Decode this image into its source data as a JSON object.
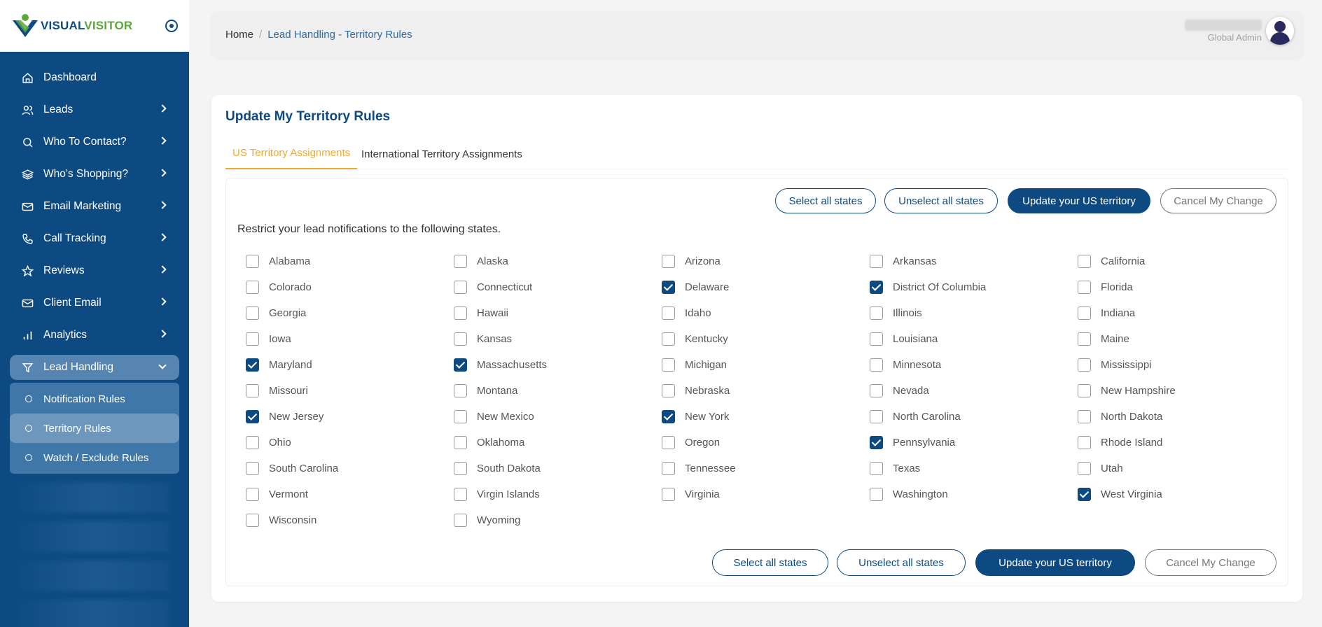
{
  "brand": {
    "part1": "VISUAL",
    "part2": "VISITOR"
  },
  "sidebar": {
    "items": [
      {
        "label": "Dashboard",
        "icon": "home-icon"
      },
      {
        "label": "Leads",
        "icon": "users-icon"
      },
      {
        "label": "Who To Contact?",
        "icon": "search-icon"
      },
      {
        "label": "Who's Shopping?",
        "icon": "layers-icon"
      },
      {
        "label": "Email Marketing",
        "icon": "mail-icon"
      },
      {
        "label": "Call Tracking",
        "icon": "phone-icon"
      },
      {
        "label": "Reviews",
        "icon": "star-icon"
      },
      {
        "label": "Client Email",
        "icon": "mail-icon"
      },
      {
        "label": "Analytics",
        "icon": "bar-chart-icon"
      },
      {
        "label": "Lead Handling",
        "icon": "filter-icon"
      }
    ],
    "subitems": [
      {
        "label": "Notification Rules"
      },
      {
        "label": "Territory Rules"
      },
      {
        "label": "Watch / Exclude Rules"
      }
    ]
  },
  "header": {
    "home": "Home",
    "sep": "/",
    "current": "Lead Handling - Territory Rules",
    "user_role": "Global Admin"
  },
  "card": {
    "title": "Update My Territory Rules",
    "tabs": [
      "US Territory Assignments",
      "International Territory Assignments"
    ],
    "buttons": {
      "select_all": "Select all states",
      "unselect_all": "Unselect all states",
      "update": "Update your US territory",
      "cancel": "Cancel My Change"
    },
    "restrict_text": "Restrict your lead notifications to the following states.",
    "states": [
      [
        "Alabama",
        false
      ],
      [
        "Alaska",
        false
      ],
      [
        "Arizona",
        false
      ],
      [
        "Arkansas",
        false
      ],
      [
        "California",
        false
      ],
      [
        "Colorado",
        false
      ],
      [
        "Connecticut",
        false
      ],
      [
        "Delaware",
        true
      ],
      [
        "District Of Columbia",
        true
      ],
      [
        "Florida",
        false
      ],
      [
        "Georgia",
        false
      ],
      [
        "Hawaii",
        false
      ],
      [
        "Idaho",
        false
      ],
      [
        "Illinois",
        false
      ],
      [
        "Indiana",
        false
      ],
      [
        "Iowa",
        false
      ],
      [
        "Kansas",
        false
      ],
      [
        "Kentucky",
        false
      ],
      [
        "Louisiana",
        false
      ],
      [
        "Maine",
        false
      ],
      [
        "Maryland",
        true
      ],
      [
        "Massachusetts",
        true
      ],
      [
        "Michigan",
        false
      ],
      [
        "Minnesota",
        false
      ],
      [
        "Mississippi",
        false
      ],
      [
        "Missouri",
        false
      ],
      [
        "Montana",
        false
      ],
      [
        "Nebraska",
        false
      ],
      [
        "Nevada",
        false
      ],
      [
        "New Hampshire",
        false
      ],
      [
        "New Jersey",
        true
      ],
      [
        "New Mexico",
        false
      ],
      [
        "New York",
        true
      ],
      [
        "North Carolina",
        false
      ],
      [
        "North Dakota",
        false
      ],
      [
        "Ohio",
        false
      ],
      [
        "Oklahoma",
        false
      ],
      [
        "Oregon",
        false
      ],
      [
        "Pennsylvania",
        true
      ],
      [
        "Rhode Island",
        false
      ],
      [
        "South Carolina",
        false
      ],
      [
        "South Dakota",
        false
      ],
      [
        "Tennessee",
        false
      ],
      [
        "Texas",
        false
      ],
      [
        "Utah",
        false
      ],
      [
        "Vermont",
        false
      ],
      [
        "Virgin Islands",
        false
      ],
      [
        "Virginia",
        false
      ],
      [
        "Washington",
        false
      ],
      [
        "West Virginia",
        true
      ],
      [
        "Wisconsin",
        false
      ],
      [
        "Wyoming",
        false
      ]
    ]
  },
  "colors": {
    "primary": "#0d4a82",
    "accent_tab": "#f0a830",
    "brand_green": "#5aa83c"
  }
}
